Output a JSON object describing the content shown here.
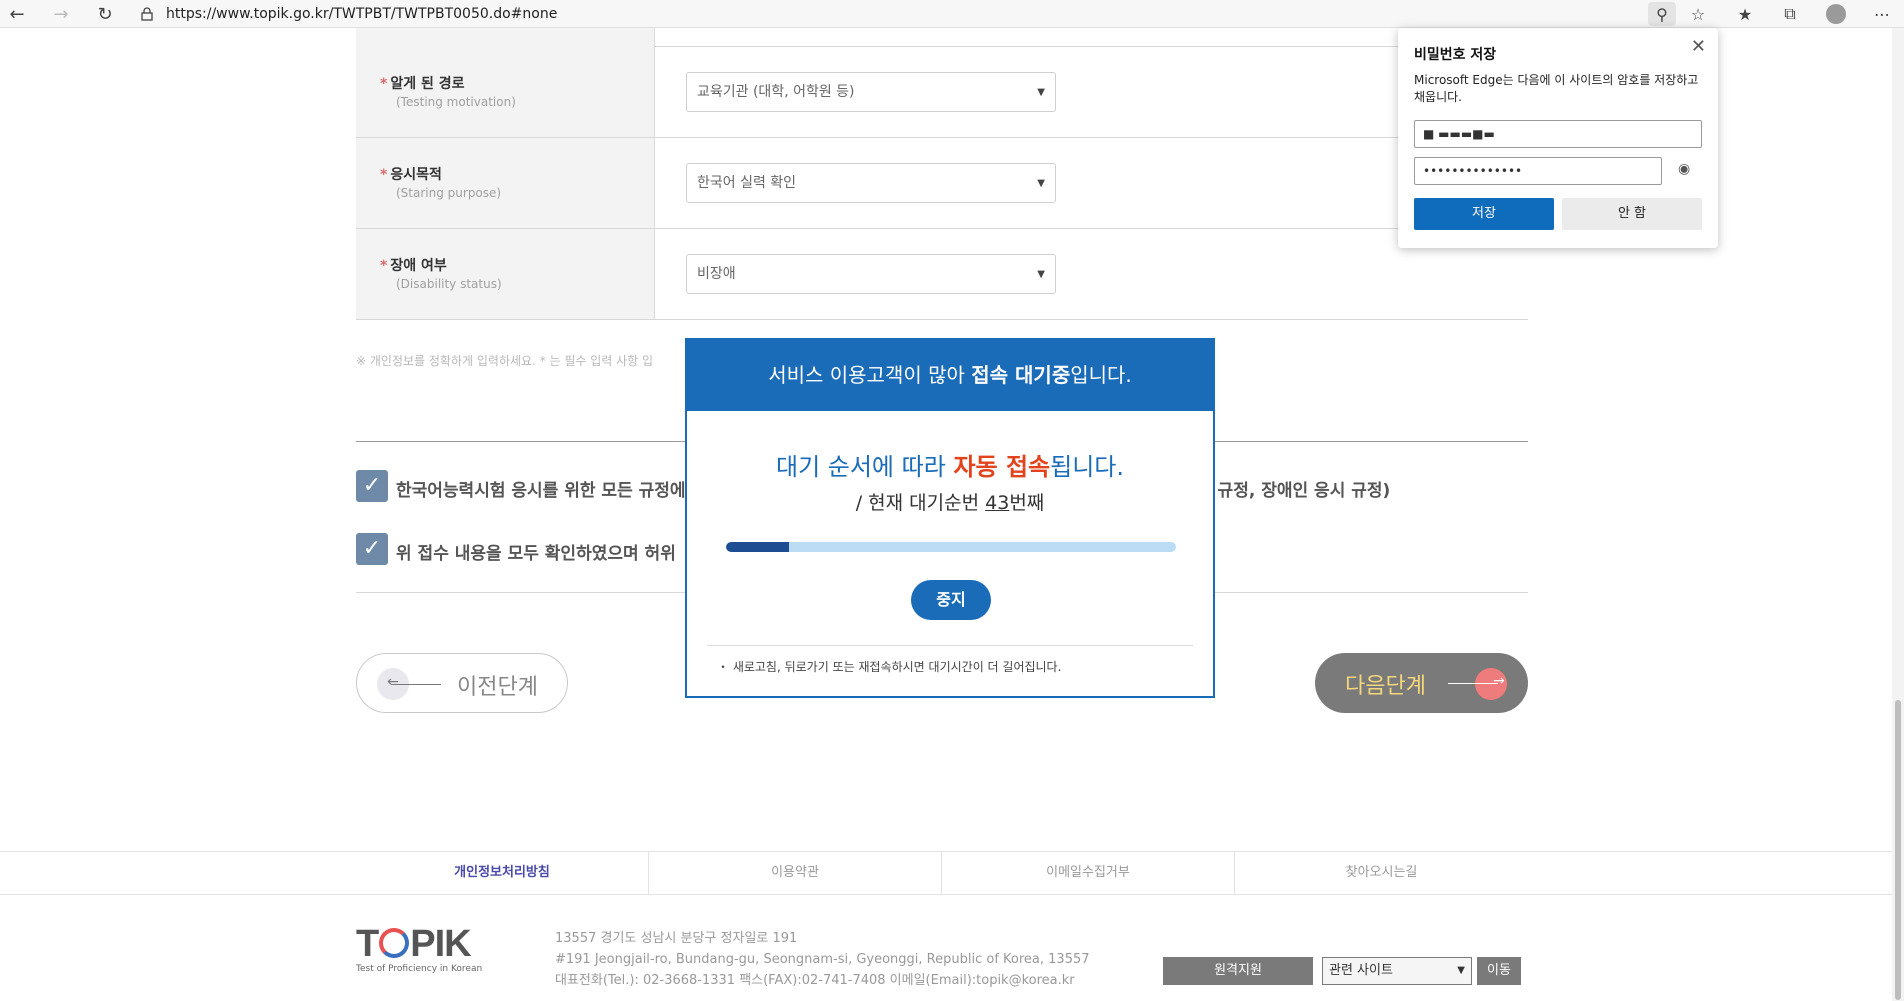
{
  "browser": {
    "url": "https://www.topik.go.kr/TWTPBT/TWTPBT0050.do#none",
    "back_icon": "back-arrow-icon",
    "forward_icon": "forward-arrow-icon",
    "refresh_icon": "refresh-icon"
  },
  "form": {
    "rows": [
      {
        "label": "알게 된 경로",
        "sub": "(Testing motivation)",
        "value": "교육기관 (대학, 어학원 등)"
      },
      {
        "label": "응시목적",
        "sub": "(Staring purpose)",
        "value": "한국어 실력 확인"
      },
      {
        "label": "장애 여부",
        "sub": "(Disability status)",
        "value": "비장애"
      }
    ],
    "required_mark": "*",
    "note": "※ 개인정보를 정확하게 입력하세요. * 는 필수 입력 사항 입"
  },
  "agreements": [
    {
      "text": "한국어능력시험 응시를 위한 모든 규정에",
      "tail": "불 규정, 장애인 응시 규정)"
    },
    {
      "text": "위 접수 내용을 모두 확인하였으며 허위",
      "tail": ""
    }
  ],
  "buttons": {
    "prev": "이전단계",
    "next": "다음단계"
  },
  "modal": {
    "header_pre": "서비스 이용고객이 많아 ",
    "header_bold": "접속 대기중",
    "header_post": "입니다.",
    "msg_pre": "대기 순서에 따라 ",
    "msg_hl": "자동 접속",
    "msg_post": "됩니다.",
    "queue_pre": "/ 현재 대기순번 ",
    "queue_num": "43",
    "queue_post": "번째",
    "progress": 0.14,
    "stop": "중지",
    "note": "・ 새로고침, 뒤로가기 또는 재접속하시면 대기시간이 더 길어집니다."
  },
  "footer": {
    "links": [
      "개인정보처리방침",
      "이용약관",
      "이메일수집거부",
      "찾아오시는길"
    ],
    "logo_text": "TOPIK",
    "logo_tag": "Test of Proficiency in Korean",
    "address": [
      "13557 경기도 성남시 분당구 정자일로 191",
      "#191 Jeongjail-ro, Bundang-gu, Seongnam-si, Gyeonggi, Republic of Korea, 13557",
      "대표전화(Tel.): 02-3668-1331 팩스(FAX):02-741-7408 이메일(Email):topik@korea.kr"
    ],
    "remote": "원격지원",
    "related": "관련 사이트",
    "go": "이동"
  },
  "password_popup": {
    "title": "비밀번호 저장",
    "desc": "Microsoft Edge는 다음에 이 사이트의 암호를 저장하고 채웁니다.",
    "username": "■ ▬▬▬■▬",
    "password": "••••••••••••••",
    "save": "저장",
    "no": "안 함"
  }
}
